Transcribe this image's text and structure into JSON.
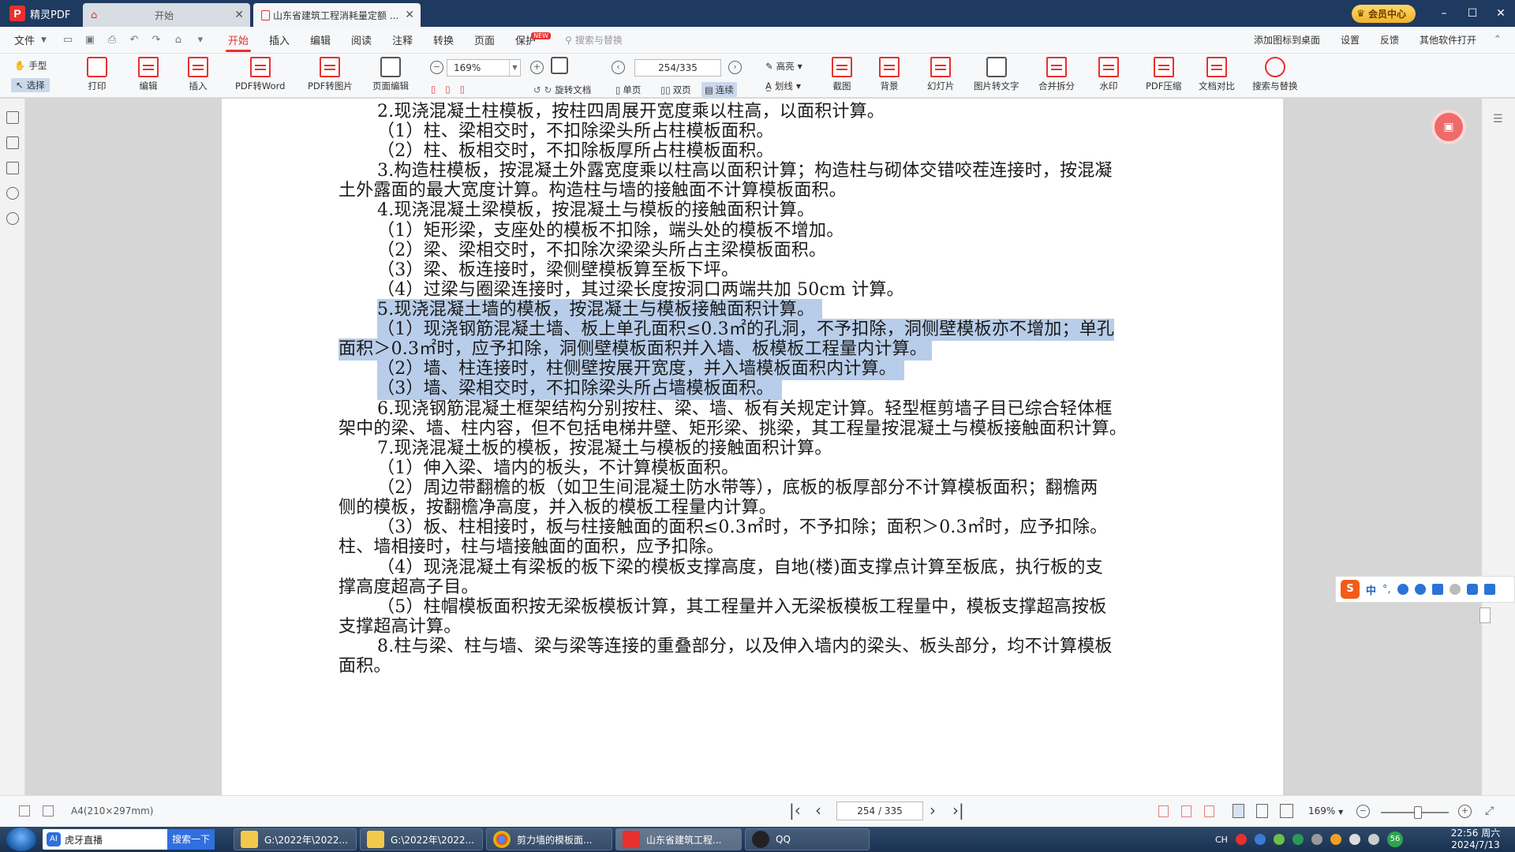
{
  "app": {
    "name": "精灵PDF"
  },
  "tabs": [
    {
      "label": "开始"
    },
    {
      "label": "山东省建筑工程消耗量定额 ..."
    }
  ],
  "vip_label": "会员中心",
  "menu": {
    "file": "文件",
    "tabs": [
      "开始",
      "插入",
      "编辑",
      "阅读",
      "注释",
      "转换",
      "页面",
      "保护"
    ],
    "new_badge": "NEW",
    "search_placeholder": "搜索与替换",
    "right": [
      "添加图标到桌面",
      "设置",
      "反馈",
      "其他软件打开"
    ]
  },
  "toolbar": {
    "hand": "手型",
    "select": "选择",
    "print": "打印",
    "edit": "编辑",
    "insert": "插入",
    "pdf_to_word": "PDF转Word",
    "pdf_to_image": "PDF转图片",
    "page_edit": "页面编辑",
    "zoom": "169%",
    "rotate": "旋转文档",
    "page_indicator": "254/335",
    "single": "单页",
    "double": "双页",
    "continuous": "连续",
    "highlight": "高亮",
    "underline": "划线",
    "screenshot": "截图",
    "background": "背景",
    "slideshow": "幻灯片",
    "image_to_text": "图片转文字",
    "merge_split": "合并拆分",
    "watermark": "水印",
    "compress": "PDF压缩",
    "compare": "文档对比",
    "search_replace": "搜索与替换"
  },
  "document": {
    "lines": [
      "2.现浇混凝土柱模板，按柱四周展开宽度乘以柱高，以面积计算。",
      "（1）柱、梁相交时，不扣除梁头所占柱模板面积。",
      "（2）柱、板相交时，不扣除板厚所占柱模板面积。",
      "3.构造柱模板，按混凝土外露宽度乘以柱高以面积计算；构造柱与砌体交错咬茬连接时，按混凝",
      "土外露面的最大宽度计算。构造柱与墙的接触面不计算模板面积。",
      "4.现浇混凝土梁模板，按混凝土与模板的接触面积计算。",
      "（1）矩形梁，支座处的模板不扣除，端头处的模板不增加。",
      "（2）梁、梁相交时，不扣除次梁梁头所占主梁模板面积。",
      "（3）梁、板连接时，梁侧壁模板算至板下坪。",
      "（4）过梁与圈梁连接时，其过梁长度按洞口两端共加 50cm 计算。",
      "5.现浇混凝土墙的模板，按混凝土与模板接触面积计算。",
      "（1）现浇钢筋混凝土墙、板上单孔面积≤0.3㎡的孔洞，不予扣除，洞侧壁模板亦不增加；单孔",
      "面积＞0.3㎡时，应予扣除，洞侧壁模板面积并入墙、板模板工程量内计算。",
      "（2）墙、柱连接时，柱侧壁按展开宽度，并入墙模板面积内计算。",
      "（3）墙、梁相交时，不扣除梁头所占墙模板面积。",
      "6.现浇钢筋混凝土框架结构分别按柱、梁、墙、板有关规定计算。轻型框剪墙子目已综合轻体框",
      "架中的梁、墙、柱内容，但不包括电梯井壁、矩形梁、挑梁，其工程量按混凝土与模板接触面积计算。",
      "7.现浇混凝土板的模板，按混凝土与模板的接触面积计算。",
      "（1）伸入梁、墙内的板头，不计算模板面积。",
      "（2）周边带翻檐的板（如卫生间混凝土防水带等），底板的板厚部分不计算模板面积；翻檐两",
      "侧的模板，按翻檐净高度，并入板的模板工程量内计算。",
      "（3）板、柱相接时，板与柱接触面的面积≤0.3㎡时，不予扣除；面积＞0.3㎡时，应予扣除。",
      "柱、墙相接时，柱与墙接触面的面积，应予扣除。",
      "（4）现浇混凝土有梁板的板下梁的模板支撑高度，自地(楼)面支撑点计算至板底，执行板的支",
      "撑高度超高子目。",
      "（5）柱帽模板面积按无梁板模板计算，其工程量并入无梁板模板工程量中，模板支撑超高按板",
      "支撑超高计算。",
      "8.柱与梁、柱与墙、梁与梁等连接的重叠部分，以及伸入墙内的梁头、板头部分，均不计算模板",
      "面积。"
    ]
  },
  "ime": {
    "lang": "中",
    "punct": "°,"
  },
  "status": {
    "page_size": "A4(210×297mm)",
    "page_indicator": "254 / 335",
    "zoom": "169%"
  },
  "taskbar": {
    "search_app": "虎牙直播",
    "search_button": "搜索一下",
    "tasks": [
      "G:\\2022年\\2022...",
      "G:\\2022年\\2022...",
      "剪力墙的模板面...",
      "山东省建筑工程...",
      "QQ"
    ],
    "tray_lang": "CH",
    "tray_badge": "56",
    "time": "22:56 周六",
    "date": "2024/7/13"
  }
}
